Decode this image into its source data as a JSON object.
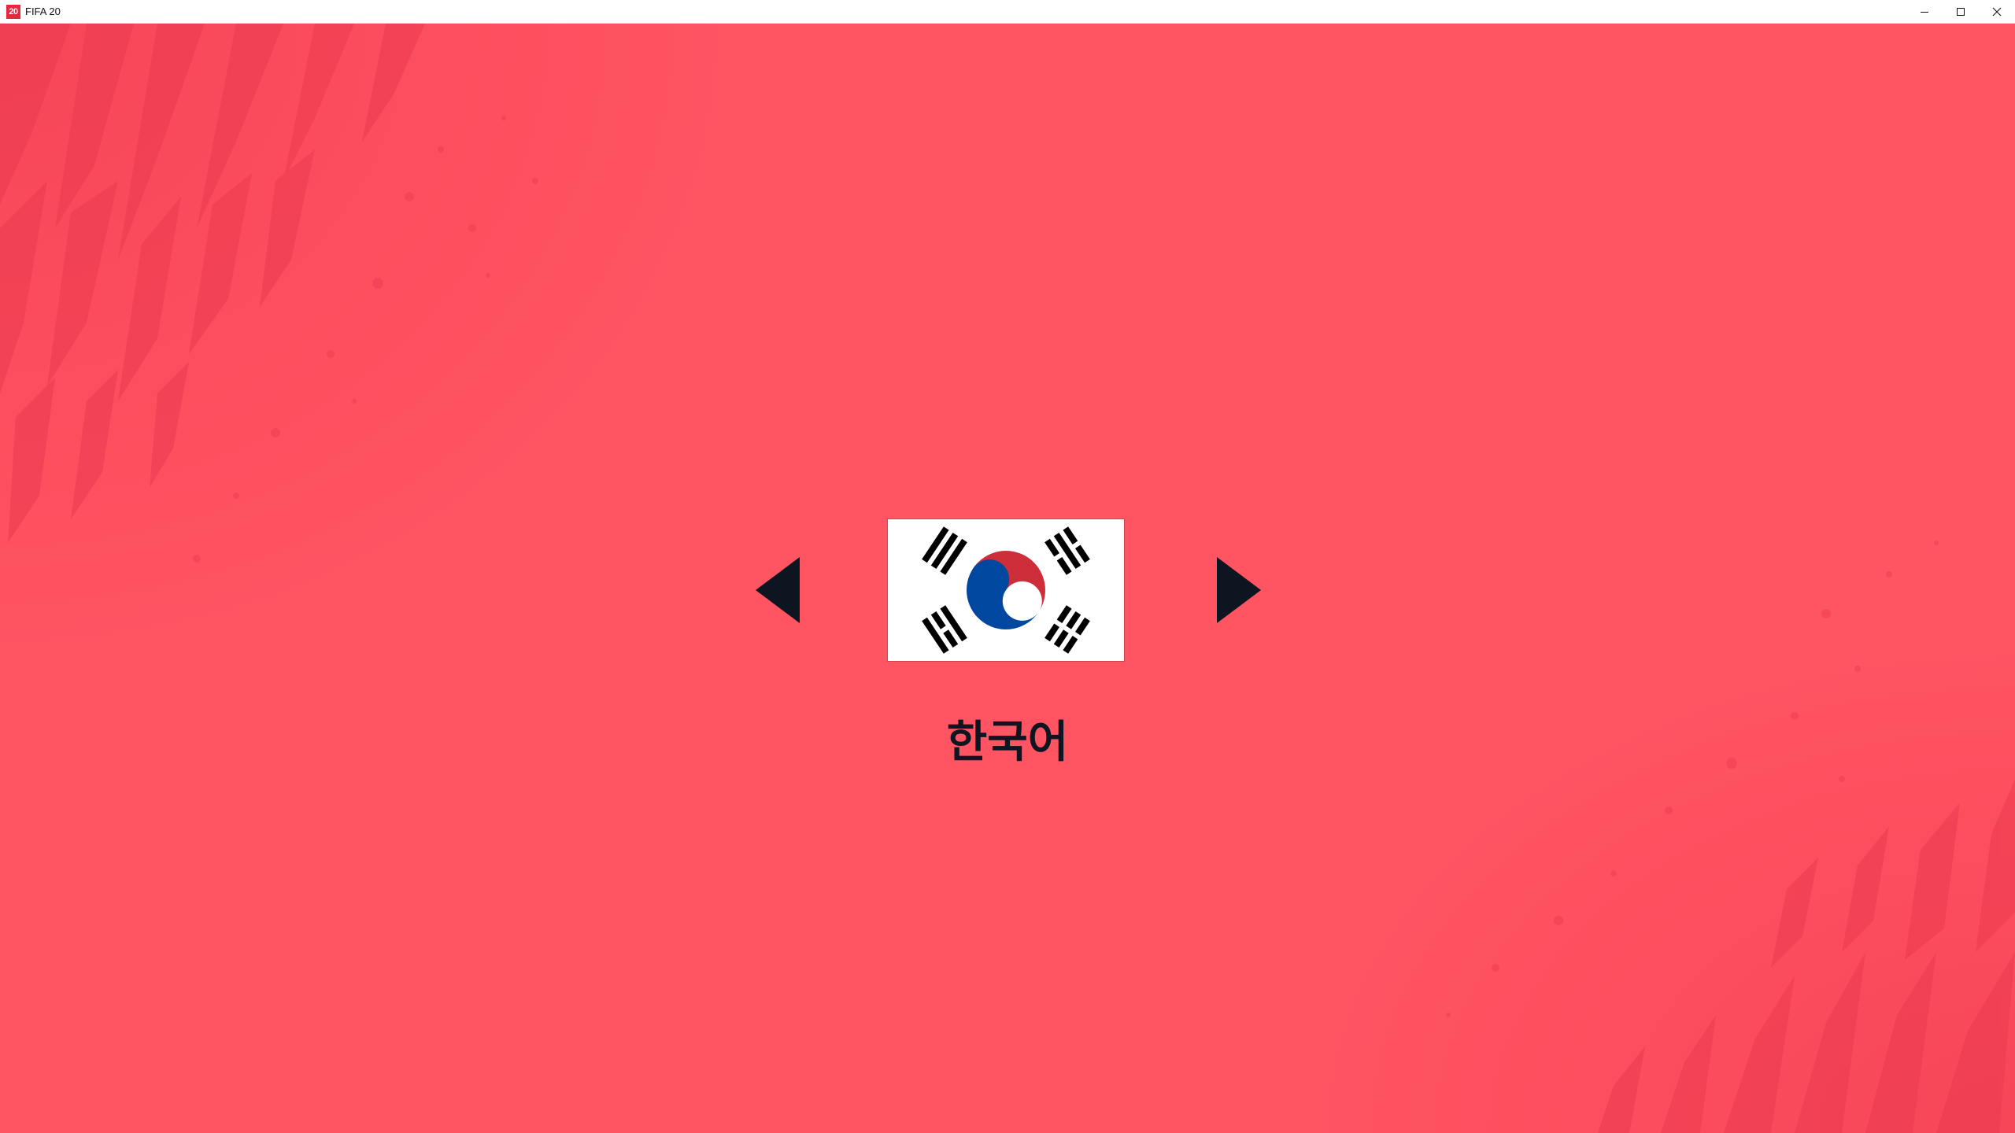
{
  "window": {
    "app_icon_text": "20",
    "title": "FIFA 20",
    "controls": {
      "minimize_icon": "minimize-icon",
      "maximize_icon": "maximize-icon",
      "close_icon": "close-icon"
    }
  },
  "language_selector": {
    "previous_icon": "triangle-left-icon",
    "next_icon": "triangle-right-icon",
    "flag": "south-korea-flag",
    "selected_language": "한국어"
  },
  "colors": {
    "background": "#ff5462",
    "texture": "#f03c52",
    "arrow": "#0c1520",
    "label": "#0c1520",
    "flag_red": "#cd2e3a",
    "flag_blue": "#0047a0",
    "flag_black": "#000000"
  }
}
